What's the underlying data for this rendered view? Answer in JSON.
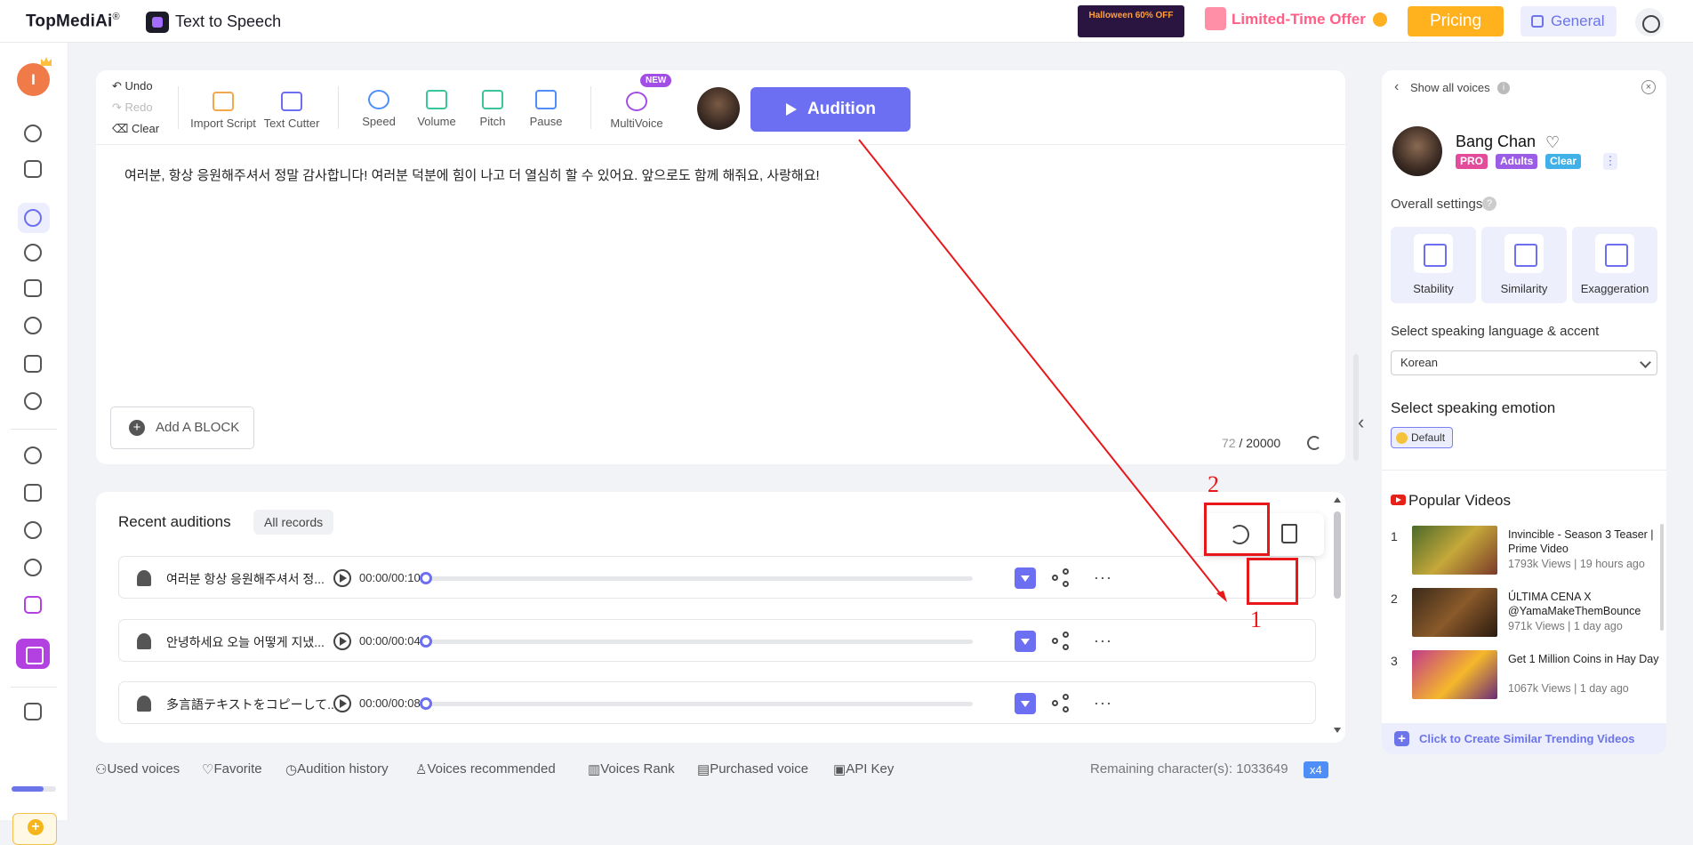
{
  "header": {
    "brand": "TopMediAi",
    "brand_reg": "®",
    "app_name": "Text to Speech",
    "promo_banner": "Halloween 60% OFF",
    "offer_label": "Limited-Time Offer",
    "pricing_label": "Pricing",
    "general_label": "General",
    "colors": {
      "pricing": "#ffb21e",
      "offer": "#ff5f86",
      "accent": "#6c6ff2"
    }
  },
  "sidebar": {
    "user_initial": "I",
    "icons": [
      "dashboard-icon",
      "folder-icon",
      "text-to-speech-icon",
      "voice-icon",
      "video-icon",
      "microphone-icon",
      "pen-icon",
      "voice-clone-icon",
      "globe-icon",
      "music-icon",
      "disc-icon",
      "tiktok-icon",
      "media-icon",
      "calendar-icon",
      "apps-icon",
      "add-credit-icon"
    ]
  },
  "toolbar": {
    "undo": "Undo",
    "redo": "Redo",
    "clear": "Clear",
    "import_script": "Import Script",
    "text_cutter": "Text Cutter",
    "speed": "Speed",
    "volume": "Volume",
    "pitch": "Pitch",
    "pause": "Pause",
    "multivoice": "MultiVoice",
    "new_badge": "NEW",
    "audition": "Audition"
  },
  "editor": {
    "script_text": "여러분, 항상 응원해주셔서 정말 감사합니다! 여러분 덕분에 힘이 나고 더 열심히 할 수 있어요. 앞으로도 함께 해줘요, 사랑해요!",
    "add_block": "Add A BLOCK",
    "char_used": "72",
    "char_sep": " / ",
    "char_max": "20000"
  },
  "recent": {
    "title": "Recent auditions",
    "all_records": "All records",
    "rows": [
      {
        "text": "여러분 항상 응원해주셔서 정...",
        "time": "00:00/00:10",
        "progress": 0
      },
      {
        "text": "안녕하세요 오늘 어떻게 지냈...",
        "time": "00:00/00:04",
        "progress": 0
      },
      {
        "text": "多言語テキストをコピーして...",
        "time": "00:00/00:08",
        "progress": 0
      }
    ]
  },
  "footer": {
    "used_voices": "Used voices",
    "favorite": "Favorite",
    "audition_history": "Audition history",
    "voices_recommended": "Voices recommended",
    "voices_rank": "Voices Rank",
    "purchased_voice": "Purchased voice",
    "api_key": "API Key",
    "remaining": "Remaining character(s): 1033649",
    "multiplier": "x4"
  },
  "panel": {
    "show_all_voices": "Show all voices",
    "voice_name": "Bang Chan",
    "tags": [
      {
        "label": "PRO",
        "color": "#e24c9b"
      },
      {
        "label": "Adults",
        "color": "#9b5de5"
      },
      {
        "label": "Clear",
        "color": "#3fb0e8"
      }
    ],
    "tag_more": "⋮",
    "overall_settings": "Overall settings",
    "settings": [
      "Stability",
      "Similarity",
      "Exaggeration"
    ],
    "lang_title": "Select speaking language & accent",
    "lang_value": "Korean",
    "emotion_title": "Select speaking emotion",
    "emotion_value": "Default",
    "popular_title": "Popular Videos",
    "videos": [
      {
        "num": "1",
        "title": "Invincible - Season 3 Teaser | Prime Video",
        "meta": "1793k Views | 19 hours ago"
      },
      {
        "num": "2",
        "title": "ÚLTIMA CENA X @YamaMakeThemBounce",
        "meta": "971k Views | 1 day ago"
      },
      {
        "num": "3",
        "title": "Get 1 Million Coins in Hay Day",
        "meta": "1067k Views | 1 day ago"
      }
    ],
    "create_similar": "Click to Create Similar Trending Videos"
  },
  "annotations": {
    "label1": "1",
    "label2": "2",
    "color": "#e8181a"
  }
}
